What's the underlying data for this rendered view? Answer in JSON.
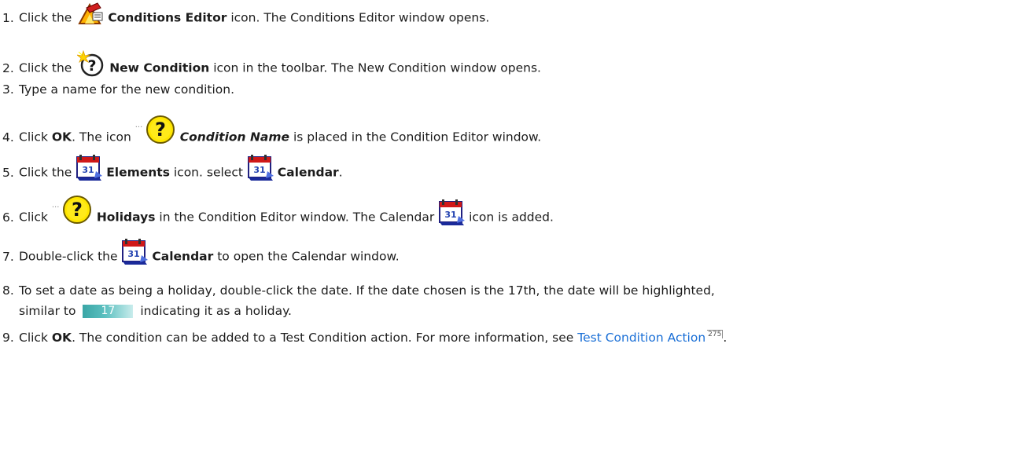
{
  "steps": [
    {
      "num": "1.",
      "pre": "Click the",
      "bold": "Conditions Editor",
      "post": "icon. The Conditions Editor window opens."
    },
    {
      "num": "2.",
      "pre": "Click the",
      "bold": "New Condition",
      "post": "icon in the toolbar. The New Condition window opens."
    },
    {
      "num": "3.",
      "text": "Type a name for the new condition."
    },
    {
      "num": "4.",
      "pre": "Click",
      "bold": "OK",
      "mid": ". The icon",
      "bold_italic": "Condition Name",
      "post": "is placed in the Condition Editor window."
    },
    {
      "num": "5.",
      "pre": "Click the",
      "bold": "Elements",
      "mid": "icon. select",
      "bold2": "Calendar",
      "post": "."
    },
    {
      "num": "6.",
      "pre": "Click",
      "bold": "Holidays",
      "mid": "in the Condition Editor window. The Calendar",
      "post": "icon is added."
    },
    {
      "num": "7.",
      "pre": "Double-click the",
      "bold": "Calendar",
      "post": "to open the Calendar window."
    },
    {
      "num": "8.",
      "line1": "To set a date as being a holiday, double-click the date. If the date chosen is the 17th, the date will be highlighted,",
      "pre2": "similar to",
      "highlight": "17",
      "post2": "indicating it as a holiday."
    },
    {
      "num": "9.",
      "pre": "Click",
      "bold": "OK",
      "mid": ". The condition can be added to a Test Condition action. For more information, see",
      "link": "Test Condition Action",
      "ref": "275",
      "post": "."
    }
  ],
  "icons": {
    "conditions_editor": "conditions-editor-icon",
    "new_condition": "new-condition-icon",
    "condition": "condition-question-icon",
    "calendar": "calendar-icon"
  },
  "colors": {
    "link": "#1a6fd6",
    "highlight": "#3aa6a6"
  }
}
